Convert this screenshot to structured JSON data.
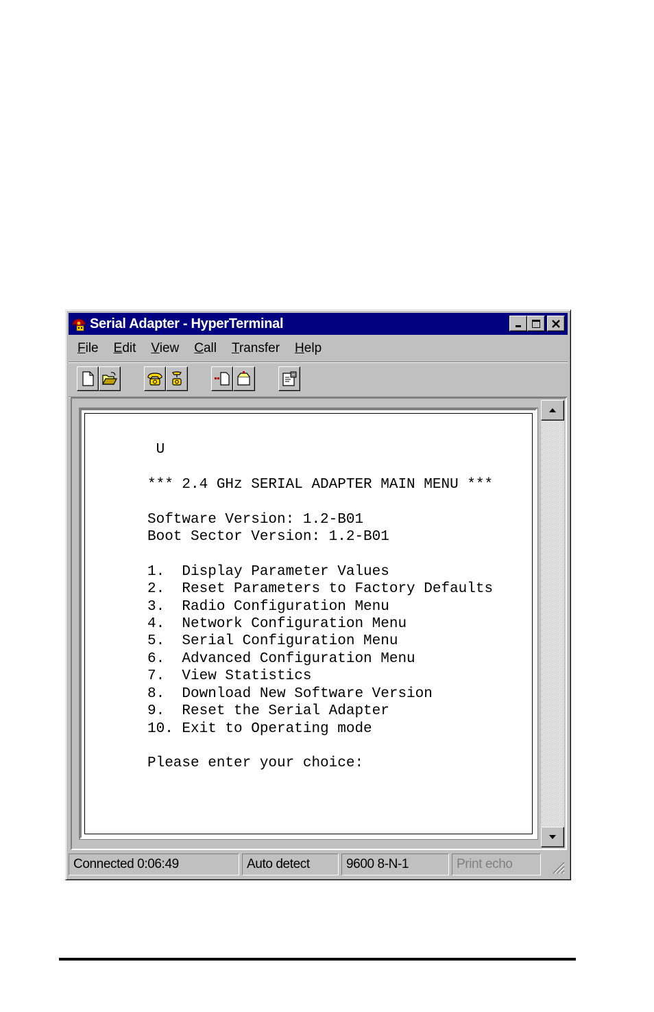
{
  "window": {
    "title": "Serial Adapter - HyperTerminal",
    "title_bar_color": "#000080",
    "controls": [
      "minimize-icon",
      "maximize-icon",
      "close-icon"
    ]
  },
  "menubar": {
    "items": [
      {
        "accel": "F",
        "rest": "ile"
      },
      {
        "accel": "E",
        "rest": "dit"
      },
      {
        "accel": "V",
        "rest": "iew"
      },
      {
        "accel": "C",
        "rest": "all"
      },
      {
        "accel": "T",
        "rest": "ransfer"
      },
      {
        "accel": "H",
        "rest": "elp"
      }
    ]
  },
  "toolbar": {
    "buttons": [
      "new-icon",
      "open-icon",
      "connect-icon",
      "disconnect-icon",
      "send-icon",
      "receive-icon",
      "properties-icon"
    ]
  },
  "terminal": {
    "lines": [
      " U",
      "",
      "*** 2.4 GHz SERIAL ADAPTER MAIN MENU ***",
      "",
      "Software Version: 1.2-B01",
      "Boot Sector Version: 1.2-B01",
      "",
      "1.  Display Parameter Values",
      "2.  Reset Parameters to Factory Defaults",
      "3.  Radio Configuration Menu",
      "4.  Network Configuration Menu",
      "5.  Serial Configuration Menu",
      "6.  Advanced Configuration Menu",
      "7.  View Statistics",
      "8.  Download New Software Version",
      "9.  Reset the Serial Adapter",
      "10. Exit to Operating mode",
      "",
      "Please enter your choice:"
    ]
  },
  "statusbar": {
    "connection": "Connected 0:06:49",
    "detect": "Auto detect",
    "settings": "9600 8-N-1",
    "echo": "Print echo"
  }
}
